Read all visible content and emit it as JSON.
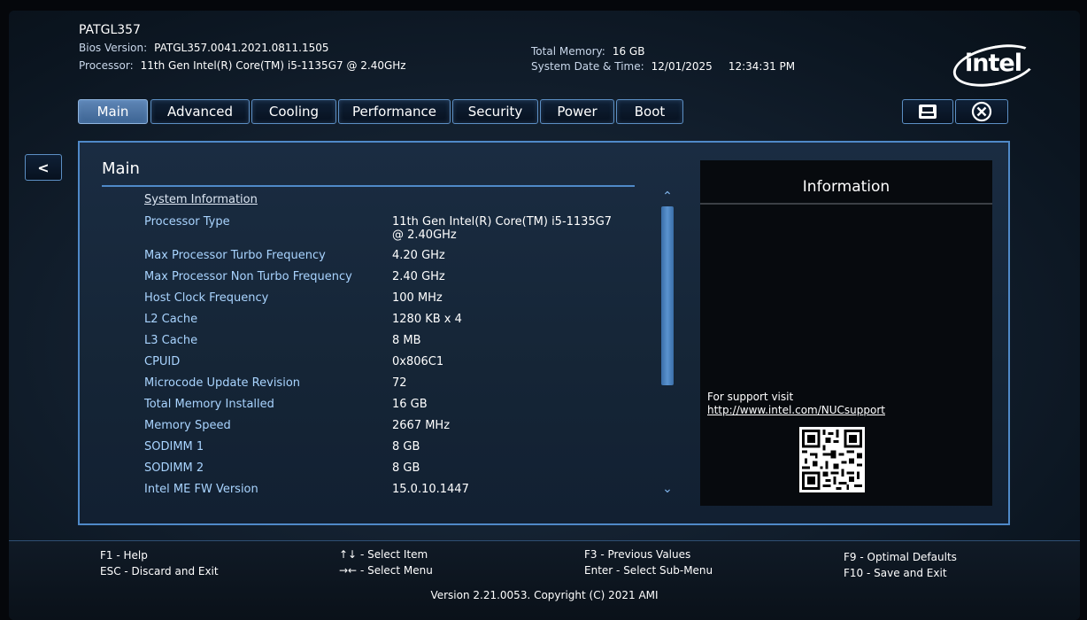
{
  "header": {
    "board_name": "PATGL357",
    "bios_version_label": "Bios Version:",
    "bios_version": "PATGL357.0041.2021.0811.1505",
    "processor_label": "Processor:",
    "processor": "11th Gen Intel(R) Core(TM) i5-1135G7 @ 2.40GHz",
    "total_memory_label": "Total Memory:",
    "total_memory": "16 GB",
    "date_time_label": "System Date & Time:",
    "date": "12/01/2025",
    "time": "12:34:31 PM",
    "logo_text": "intel"
  },
  "tabs": [
    {
      "label": "Main",
      "active": true
    },
    {
      "label": "Advanced",
      "active": false
    },
    {
      "label": "Cooling",
      "active": false
    },
    {
      "label": "Performance",
      "active": false
    },
    {
      "label": "Security",
      "active": false
    },
    {
      "label": "Power",
      "active": false
    },
    {
      "label": "Boot",
      "active": false
    }
  ],
  "toolbar": {
    "save_icon": "save-icon",
    "exit_icon": "close-icon",
    "back_label": "<"
  },
  "main": {
    "title": "Main",
    "section_heading": "System Information",
    "rows": [
      {
        "label": "Processor Type",
        "value": "11th Gen Intel(R) Core(TM) i5-1135G7 @ 2.40GHz"
      },
      {
        "label": "Max Processor Turbo Frequency",
        "value": "4.20 GHz"
      },
      {
        "label": "Max Processor Non Turbo Frequency",
        "value": "2.40 GHz"
      },
      {
        "label": "Host Clock Frequency",
        "value": "100 MHz"
      },
      {
        "label": "L2 Cache",
        "value": "1280 KB x 4"
      },
      {
        "label": "L3 Cache",
        "value": "8 MB"
      },
      {
        "label": "CPUID",
        "value": "0x806C1"
      },
      {
        "label": "Microcode Update Revision",
        "value": "72"
      },
      {
        "label": "Total Memory Installed",
        "value": "16 GB"
      },
      {
        "label": "Memory Speed",
        "value": "2667 MHz"
      },
      {
        "label": "SODIMM 1",
        "value": "8 GB"
      },
      {
        "label": "SODIMM 2",
        "value": "8 GB"
      },
      {
        "label": "Intel ME FW Version",
        "value": "15.0.10.1447"
      }
    ]
  },
  "info_panel": {
    "title": "Information",
    "support_text": "For support visit",
    "support_link": "http://www.intel.com/NUCsupport"
  },
  "footer": {
    "f1": "F1",
    "f1_action": "- Help",
    "esc": "ESC",
    "esc_action": "- Discard and Exit",
    "select_item_keys": "↑↓",
    "select_item": "- Select Item",
    "select_menu_keys": "→←",
    "select_menu": "- Select Menu",
    "f3": "F3",
    "f3_action": "- Previous Values",
    "enter": "Enter",
    "enter_action": "- Select Sub-Menu",
    "f9": "F9",
    "f9_action": "- Optimal Defaults",
    "f10": "F10",
    "f10_action": "- Save and Exit",
    "copyright": "Version 2.21.0053. Copyright (C) 2021 AMI"
  },
  "colors": {
    "accent": "#4f89c8",
    "label_blue": "#a9d4ff",
    "active_tab": "#4f78a8"
  }
}
